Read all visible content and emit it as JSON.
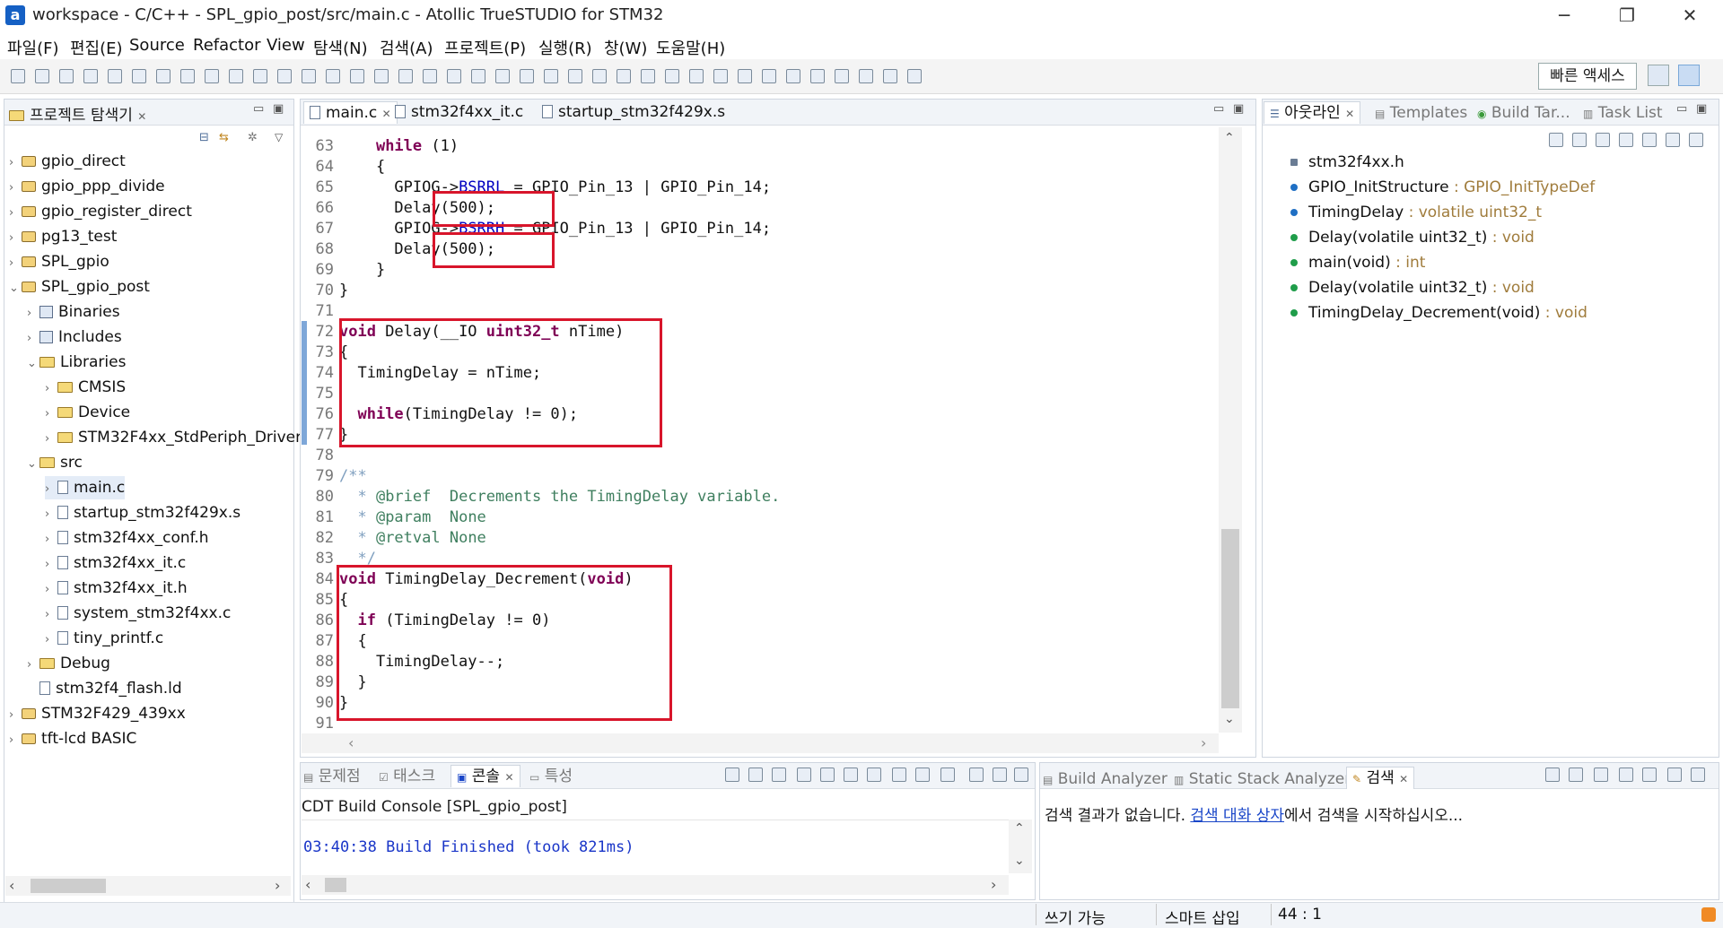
{
  "window": {
    "title": "workspace - C/C++ - SPL_gpio_post/src/main.c - Atollic TrueSTUDIO for STM32",
    "logo_letter": "a",
    "minimize": "─",
    "maximize": "❐",
    "close": "✕"
  },
  "menu": [
    "파일(F)",
    "편집(E)",
    "Source",
    "Refactor",
    "View",
    "탐색(N)",
    "검색(A)",
    "프로젝트(P)",
    "실행(R)",
    "창(W)",
    "도움말(H)"
  ],
  "toolbar": {
    "quick_access": "빠른 액세스"
  },
  "explorer": {
    "title": "프로젝트 탐색기",
    "items": [
      {
        "label": "gpio_direct",
        "depth": 0,
        "kind": "project",
        "twisty": "›"
      },
      {
        "label": "gpio_ppp_divide",
        "depth": 0,
        "kind": "project",
        "twisty": "›"
      },
      {
        "label": "gpio_register_direct",
        "depth": 0,
        "kind": "project",
        "twisty": "›"
      },
      {
        "label": "pg13_test",
        "depth": 0,
        "kind": "project",
        "twisty": "›"
      },
      {
        "label": "SPL_gpio",
        "depth": 0,
        "kind": "project",
        "twisty": "›"
      },
      {
        "label": "SPL_gpio_post",
        "depth": 0,
        "kind": "project",
        "twisty": "⌄"
      },
      {
        "label": "Binaries",
        "depth": 1,
        "kind": "lib",
        "twisty": "›"
      },
      {
        "label": "Includes",
        "depth": 1,
        "kind": "lib",
        "twisty": "›"
      },
      {
        "label": "Libraries",
        "depth": 1,
        "kind": "folder",
        "twisty": "⌄"
      },
      {
        "label": "CMSIS",
        "depth": 2,
        "kind": "folder",
        "twisty": "›"
      },
      {
        "label": "Device",
        "depth": 2,
        "kind": "folder",
        "twisty": "›"
      },
      {
        "label": "STM32F4xx_StdPeriph_Driver",
        "depth": 2,
        "kind": "folder",
        "twisty": "›"
      },
      {
        "label": "src",
        "depth": 1,
        "kind": "folder",
        "twisty": "⌄"
      },
      {
        "label": "main.c",
        "depth": 2,
        "kind": "file",
        "twisty": "›",
        "selected": true
      },
      {
        "label": "startup_stm32f429x.s",
        "depth": 2,
        "kind": "file",
        "twisty": "›"
      },
      {
        "label": "stm32f4xx_conf.h",
        "depth": 2,
        "kind": "file",
        "twisty": "›"
      },
      {
        "label": "stm32f4xx_it.c",
        "depth": 2,
        "kind": "file",
        "twisty": "›"
      },
      {
        "label": "stm32f4xx_it.h",
        "depth": 2,
        "kind": "file",
        "twisty": "›"
      },
      {
        "label": "system_stm32f4xx.c",
        "depth": 2,
        "kind": "file",
        "twisty": "›"
      },
      {
        "label": "tiny_printf.c",
        "depth": 2,
        "kind": "file",
        "twisty": "›"
      },
      {
        "label": "Debug",
        "depth": 1,
        "kind": "folder",
        "twisty": "›"
      },
      {
        "label": "stm32f4_flash.ld",
        "depth": 1,
        "kind": "file",
        "twisty": ""
      },
      {
        "label": "STM32F429_439xx",
        "depth": 0,
        "kind": "project",
        "twisty": "›"
      },
      {
        "label": "tft-lcd BASIC",
        "depth": 0,
        "kind": "project",
        "twisty": "›"
      }
    ]
  },
  "editor": {
    "tabs": [
      "main.c",
      "stm32f4xx_it.c",
      "startup_stm32f429x.s"
    ],
    "lines": [
      {
        "n": "63",
        "parts": [
          [
            "    ",
            ""
          ],
          [
            "while",
            "kw"
          ],
          [
            " (1)",
            ""
          ]
        ]
      },
      {
        "n": "64",
        "parts": [
          [
            "    {",
            ""
          ]
        ]
      },
      {
        "n": "65",
        "parts": [
          [
            "      GPIOG->",
            ""
          ],
          [
            "BSRRL",
            "fld"
          ],
          [
            " = GPIO_Pin_13 | GPIO_Pin_14;",
            ""
          ]
        ]
      },
      {
        "n": "66",
        "parts": [
          [
            "      Delay(500);",
            ""
          ]
        ]
      },
      {
        "n": "67",
        "parts": [
          [
            "      GPIOG->",
            ""
          ],
          [
            "BSRRH",
            "fld"
          ],
          [
            " = GPIO_Pin_13 | GPIO_Pin_14;",
            ""
          ]
        ]
      },
      {
        "n": "68",
        "parts": [
          [
            "      Delay(500);",
            ""
          ]
        ]
      },
      {
        "n": "69",
        "parts": [
          [
            "    }",
            ""
          ]
        ]
      },
      {
        "n": "70",
        "parts": [
          [
            "}",
            ""
          ]
        ]
      },
      {
        "n": "71",
        "parts": [
          [
            "",
            ""
          ]
        ]
      },
      {
        "n": "72",
        "parts": [
          [
            "void",
            "kw"
          ],
          [
            " Delay(__IO ",
            ""
          ],
          [
            "uint32_t",
            "kw"
          ],
          [
            " nTime)",
            ""
          ]
        ]
      },
      {
        "n": "73",
        "parts": [
          [
            "{",
            ""
          ]
        ]
      },
      {
        "n": "74",
        "parts": [
          [
            "  TimingDelay = nTime;",
            ""
          ]
        ]
      },
      {
        "n": "75",
        "parts": [
          [
            "",
            ""
          ]
        ]
      },
      {
        "n": "76",
        "parts": [
          [
            "  ",
            ""
          ],
          [
            "while",
            "kw"
          ],
          [
            "(TimingDelay != 0);",
            ""
          ]
        ]
      },
      {
        "n": "77",
        "parts": [
          [
            "}",
            ""
          ]
        ]
      },
      {
        "n": "78",
        "parts": [
          [
            "",
            ""
          ]
        ]
      },
      {
        "n": "79",
        "parts": [
          [
            "/**",
            "doc"
          ]
        ]
      },
      {
        "n": "80",
        "parts": [
          [
            "  * ",
            "doc"
          ],
          [
            "@brief",
            "cm"
          ],
          [
            "  Decrements the TimingDelay variable.",
            "cm"
          ]
        ]
      },
      {
        "n": "81",
        "parts": [
          [
            "  * ",
            "doc"
          ],
          [
            "@param",
            "cm"
          ],
          [
            "  None",
            "cm"
          ]
        ]
      },
      {
        "n": "82",
        "parts": [
          [
            "  * ",
            "doc"
          ],
          [
            "@retval",
            "cm"
          ],
          [
            " None",
            "cm"
          ]
        ]
      },
      {
        "n": "83",
        "parts": [
          [
            "  */",
            "doc"
          ]
        ]
      },
      {
        "n": "84",
        "parts": [
          [
            "void",
            "kw"
          ],
          [
            " TimingDelay_Decrement(",
            ""
          ],
          [
            "void",
            "kw"
          ],
          [
            ")",
            ""
          ]
        ]
      },
      {
        "n": "85",
        "parts": [
          [
            "{",
            ""
          ]
        ]
      },
      {
        "n": "86",
        "parts": [
          [
            "  ",
            ""
          ],
          [
            "if",
            "kw"
          ],
          [
            " (TimingDelay != 0)",
            ""
          ]
        ]
      },
      {
        "n": "87",
        "parts": [
          [
            "  {",
            ""
          ]
        ]
      },
      {
        "n": "88",
        "parts": [
          [
            "    TimingDelay--;",
            ""
          ]
        ]
      },
      {
        "n": "89",
        "parts": [
          [
            "  }",
            ""
          ]
        ]
      },
      {
        "n": "90",
        "parts": [
          [
            "}",
            ""
          ]
        ]
      },
      {
        "n": "91",
        "parts": [
          [
            "",
            ""
          ]
        ]
      }
    ]
  },
  "outline": {
    "tabs": [
      "아웃라인",
      "Templates",
      "Build Tar...",
      "Task List"
    ],
    "items": [
      {
        "name": "stm32f4xx.h",
        "type": ""
      },
      {
        "name": "GPIO_InitStructure",
        "type": " : GPIO_InitTypeDef"
      },
      {
        "name": "TimingDelay",
        "type": " : volatile uint32_t"
      },
      {
        "name": "Delay(volatile uint32_t)",
        "type": " : void"
      },
      {
        "name": "main(void)",
        "type": " : int"
      },
      {
        "name": "Delay(volatile uint32_t)",
        "type": " : void"
      },
      {
        "name": "TimingDelay_Decrement(void)",
        "type": " : void"
      }
    ]
  },
  "console": {
    "tabs": [
      "문제점",
      "태스크",
      "콘솔",
      "특성"
    ],
    "title": "CDT Build Console [SPL_gpio_post]",
    "message": "03:40:38 Build Finished (took 821ms)"
  },
  "search": {
    "tabs": [
      "Build Analyzer",
      "Static Stack Analyzer",
      "검색"
    ],
    "msg_pre": "검색 결과가 없습니다. ",
    "msg_link": "검색 대화 상자",
    "msg_post": "에서 검색을 시작하십시오..."
  },
  "status": {
    "writable": "쓰기 가능",
    "insert_mode": "스마트 삽입",
    "position": "44 : 1"
  }
}
